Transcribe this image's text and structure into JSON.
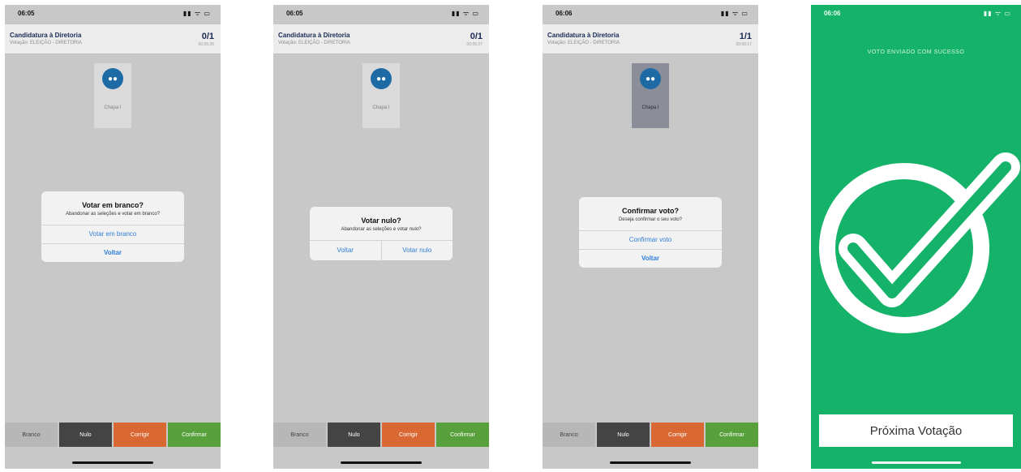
{
  "screens": [
    {
      "time": "06:05",
      "header": {
        "title": "Candidatura à Diretoria",
        "subtitle": "Votação: ELEIÇÃO - DIRETORIA",
        "count": "0/1",
        "timer": "00:05:35"
      },
      "candidate": {
        "label": "Chapa I"
      },
      "dialog": {
        "title": "Votar em branco?",
        "message": "Abandonar as seleções e votar em branco?",
        "primary": "Votar em branco",
        "secondary": "Voltar"
      }
    },
    {
      "time": "06:05",
      "header": {
        "title": "Candidatura à Diretoria",
        "subtitle": "Votação: ELEIÇÃO - DIRETORIA",
        "count": "0/1",
        "timer": "00:05:27"
      },
      "candidate": {
        "label": "Chapa I"
      },
      "dialog": {
        "title": "Votar nulo?",
        "message": "Abandonar as seleções e votar nulo?",
        "left": "Voltar",
        "right": "Votar nulo"
      }
    },
    {
      "time": "06:06",
      "header": {
        "title": "Candidatura à Diretoria",
        "subtitle": "Votação: ELEIÇÃO - DIRETORIA",
        "count": "1/1",
        "timer": "00:05:17"
      },
      "candidate": {
        "label": "Chapa I"
      },
      "dialog": {
        "title": "Confirmar voto?",
        "message": "Deseja confirmar o seu voto?",
        "primary": "Confirmar voto",
        "secondary": "Voltar"
      }
    }
  ],
  "bottom_bar": {
    "branco": "Branco",
    "nulo": "Nulo",
    "corrigir": "Corrigir",
    "confirmar": "Confirmar"
  },
  "success_screen": {
    "time": "06:06",
    "message": "VOTO ENVIADO COM SUCESSO",
    "next_button": "Próxima Votação"
  },
  "status_icons": "▮▮ ᯤ ▭",
  "colors": {
    "success_green": "#15b36a",
    "nulo": "#444444",
    "corrigir": "#d96832",
    "confirmar": "#58a03c",
    "link_blue": "#2f7fd8",
    "candidate_icon": "#1e6aa5"
  },
  "icons": {
    "candidate": "group-icon",
    "success": "check-circle-icon"
  }
}
